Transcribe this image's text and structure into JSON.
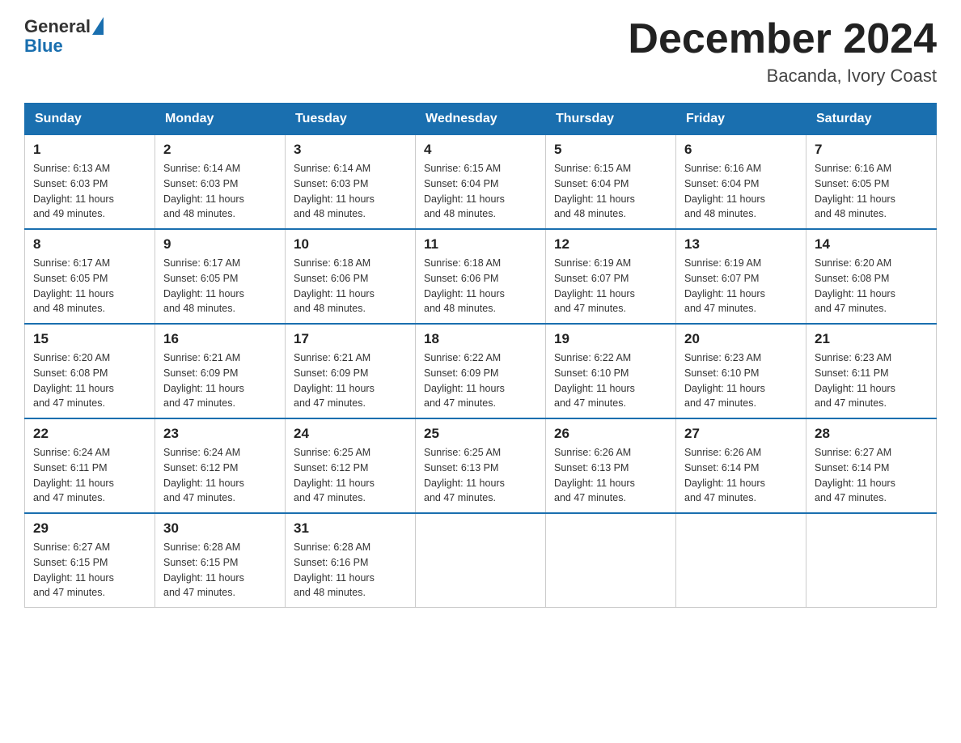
{
  "header": {
    "logo_general": "General",
    "logo_blue": "Blue",
    "month_title": "December 2024",
    "location": "Bacanda, Ivory Coast"
  },
  "weekdays": [
    "Sunday",
    "Monday",
    "Tuesday",
    "Wednesday",
    "Thursday",
    "Friday",
    "Saturday"
  ],
  "weeks": [
    [
      {
        "day": "1",
        "sunrise": "6:13 AM",
        "sunset": "6:03 PM",
        "daylight": "11 hours and 49 minutes."
      },
      {
        "day": "2",
        "sunrise": "6:14 AM",
        "sunset": "6:03 PM",
        "daylight": "11 hours and 48 minutes."
      },
      {
        "day": "3",
        "sunrise": "6:14 AM",
        "sunset": "6:03 PM",
        "daylight": "11 hours and 48 minutes."
      },
      {
        "day": "4",
        "sunrise": "6:15 AM",
        "sunset": "6:04 PM",
        "daylight": "11 hours and 48 minutes."
      },
      {
        "day": "5",
        "sunrise": "6:15 AM",
        "sunset": "6:04 PM",
        "daylight": "11 hours and 48 minutes."
      },
      {
        "day": "6",
        "sunrise": "6:16 AM",
        "sunset": "6:04 PM",
        "daylight": "11 hours and 48 minutes."
      },
      {
        "day": "7",
        "sunrise": "6:16 AM",
        "sunset": "6:05 PM",
        "daylight": "11 hours and 48 minutes."
      }
    ],
    [
      {
        "day": "8",
        "sunrise": "6:17 AM",
        "sunset": "6:05 PM",
        "daylight": "11 hours and 48 minutes."
      },
      {
        "day": "9",
        "sunrise": "6:17 AM",
        "sunset": "6:05 PM",
        "daylight": "11 hours and 48 minutes."
      },
      {
        "day": "10",
        "sunrise": "6:18 AM",
        "sunset": "6:06 PM",
        "daylight": "11 hours and 48 minutes."
      },
      {
        "day": "11",
        "sunrise": "6:18 AM",
        "sunset": "6:06 PM",
        "daylight": "11 hours and 48 minutes."
      },
      {
        "day": "12",
        "sunrise": "6:19 AM",
        "sunset": "6:07 PM",
        "daylight": "11 hours and 47 minutes."
      },
      {
        "day": "13",
        "sunrise": "6:19 AM",
        "sunset": "6:07 PM",
        "daylight": "11 hours and 47 minutes."
      },
      {
        "day": "14",
        "sunrise": "6:20 AM",
        "sunset": "6:08 PM",
        "daylight": "11 hours and 47 minutes."
      }
    ],
    [
      {
        "day": "15",
        "sunrise": "6:20 AM",
        "sunset": "6:08 PM",
        "daylight": "11 hours and 47 minutes."
      },
      {
        "day": "16",
        "sunrise": "6:21 AM",
        "sunset": "6:09 PM",
        "daylight": "11 hours and 47 minutes."
      },
      {
        "day": "17",
        "sunrise": "6:21 AM",
        "sunset": "6:09 PM",
        "daylight": "11 hours and 47 minutes."
      },
      {
        "day": "18",
        "sunrise": "6:22 AM",
        "sunset": "6:09 PM",
        "daylight": "11 hours and 47 minutes."
      },
      {
        "day": "19",
        "sunrise": "6:22 AM",
        "sunset": "6:10 PM",
        "daylight": "11 hours and 47 minutes."
      },
      {
        "day": "20",
        "sunrise": "6:23 AM",
        "sunset": "6:10 PM",
        "daylight": "11 hours and 47 minutes."
      },
      {
        "day": "21",
        "sunrise": "6:23 AM",
        "sunset": "6:11 PM",
        "daylight": "11 hours and 47 minutes."
      }
    ],
    [
      {
        "day": "22",
        "sunrise": "6:24 AM",
        "sunset": "6:11 PM",
        "daylight": "11 hours and 47 minutes."
      },
      {
        "day": "23",
        "sunrise": "6:24 AM",
        "sunset": "6:12 PM",
        "daylight": "11 hours and 47 minutes."
      },
      {
        "day": "24",
        "sunrise": "6:25 AM",
        "sunset": "6:12 PM",
        "daylight": "11 hours and 47 minutes."
      },
      {
        "day": "25",
        "sunrise": "6:25 AM",
        "sunset": "6:13 PM",
        "daylight": "11 hours and 47 minutes."
      },
      {
        "day": "26",
        "sunrise": "6:26 AM",
        "sunset": "6:13 PM",
        "daylight": "11 hours and 47 minutes."
      },
      {
        "day": "27",
        "sunrise": "6:26 AM",
        "sunset": "6:14 PM",
        "daylight": "11 hours and 47 minutes."
      },
      {
        "day": "28",
        "sunrise": "6:27 AM",
        "sunset": "6:14 PM",
        "daylight": "11 hours and 47 minutes."
      }
    ],
    [
      {
        "day": "29",
        "sunrise": "6:27 AM",
        "sunset": "6:15 PM",
        "daylight": "11 hours and 47 minutes."
      },
      {
        "day": "30",
        "sunrise": "6:28 AM",
        "sunset": "6:15 PM",
        "daylight": "11 hours and 47 minutes."
      },
      {
        "day": "31",
        "sunrise": "6:28 AM",
        "sunset": "6:16 PM",
        "daylight": "11 hours and 48 minutes."
      },
      null,
      null,
      null,
      null
    ]
  ],
  "labels": {
    "sunrise": "Sunrise:",
    "sunset": "Sunset:",
    "daylight": "Daylight:"
  }
}
